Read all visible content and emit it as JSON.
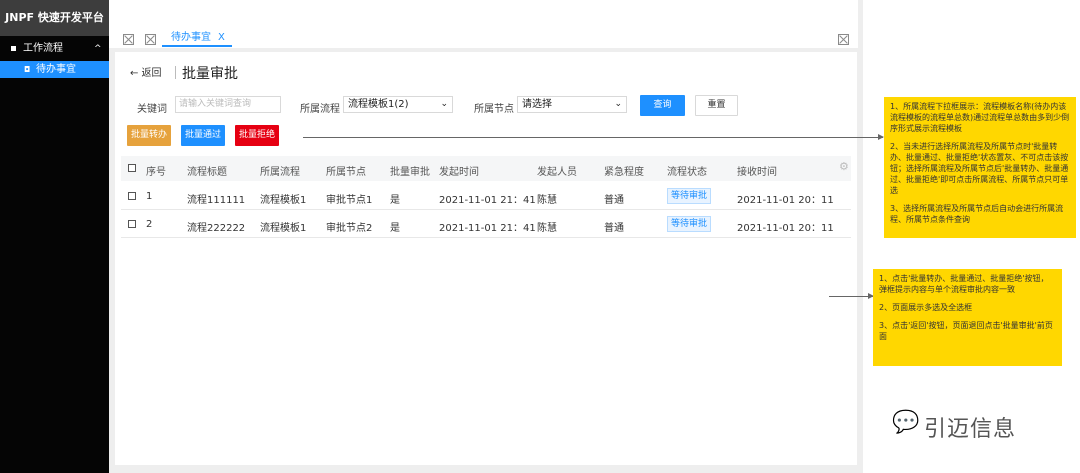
{
  "sidebar": {
    "brand": "JNPF 快速开发平台",
    "group_label": "工作流程",
    "group_caret": "^",
    "active_item_label": "待办事宜"
  },
  "tabs": {
    "active_tab": "待办事宜",
    "active_tab_close": "X"
  },
  "header": {
    "back_label": "← 返回",
    "title": "批量审批"
  },
  "filters": {
    "keyword_label": "关键词",
    "keyword_placeholder": "请输入关键词查询",
    "flow_label": "所属流程",
    "flow_value": "流程模板1(2)",
    "node_label": "所属节点",
    "node_value": "请选择",
    "query_label": "查询",
    "reset_label": "重置"
  },
  "actions": {
    "transfer_label": "批量转办",
    "approve_label": "批量通过",
    "reject_label": "批量拒绝"
  },
  "table": {
    "columns": [
      "序号",
      "流程标题",
      "所属流程",
      "所属节点",
      "批量审批",
      "发起时间",
      "发起人员",
      "紧急程度",
      "流程状态",
      "接收时间"
    ],
    "rows": [
      {
        "no": "1",
        "title": "流程111111",
        "flow": "流程模板1",
        "node": "审批节点1",
        "batch": "是",
        "start": "2021-11-01 21：41",
        "initiator": "陈慧",
        "urgency": "普通",
        "status": "等待审批",
        "received": "2021-11-01 20：11"
      },
      {
        "no": "2",
        "title": "流程222222",
        "flow": "流程模板1",
        "node": "审批节点2",
        "batch": "是",
        "start": "2021-11-01 21：41",
        "initiator": "陈慧",
        "urgency": "普通",
        "status": "等待审批",
        "received": "2021-11-01 20：11"
      }
    ]
  },
  "notes": {
    "note1": [
      "1、所属流程下拉框展示：流程模板名称(待办内该流程模板的流程单总数)通过流程单总数由多到少倒序形式展示流程模板",
      "2、当未进行选择所属流程及所属节点时'批量转办、批量通过、批量拒绝'状态置灰、不可点击该按钮；选择所属流程及所属节点后'批量转办、批量通过、批量拒绝'即可点击所属流程、所属节点只可单选",
      "3、选择所属流程及所属节点后自动会进行所属流程、所属节点条件查询"
    ],
    "note2": [
      "1、点击'批量转办、批量通过、批量拒绝'按钮，弹框提示内容与单个流程审批内容一致",
      "2、页面展示多选及全选框",
      "3、点击'返回'按钮，页面退回点击'批量审批'前页面"
    ]
  },
  "watermark": {
    "icon": "wechat-icon",
    "text": "引迈信息"
  },
  "colors": {
    "primary": "#1e90ff",
    "orange": "#e6a23c",
    "red": "#e60012",
    "note": "#ffd700",
    "sidebar": "#050505"
  }
}
